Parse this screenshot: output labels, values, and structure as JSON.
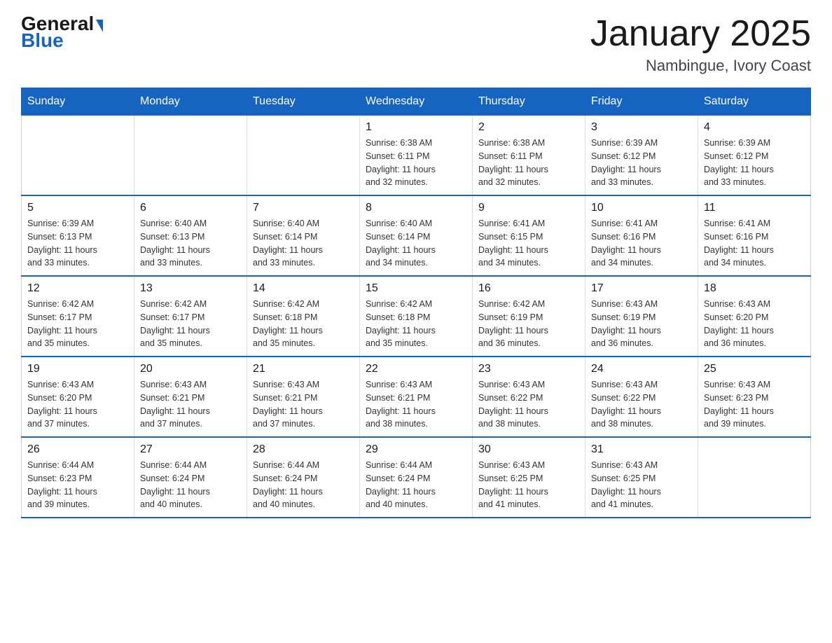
{
  "logo": {
    "general": "General",
    "blue": "Blue"
  },
  "title": "January 2025",
  "location": "Nambingue, Ivory Coast",
  "days_of_week": [
    "Sunday",
    "Monday",
    "Tuesday",
    "Wednesday",
    "Thursday",
    "Friday",
    "Saturday"
  ],
  "weeks": [
    [
      {
        "day": "",
        "info": ""
      },
      {
        "day": "",
        "info": ""
      },
      {
        "day": "",
        "info": ""
      },
      {
        "day": "1",
        "info": "Sunrise: 6:38 AM\nSunset: 6:11 PM\nDaylight: 11 hours\nand 32 minutes."
      },
      {
        "day": "2",
        "info": "Sunrise: 6:38 AM\nSunset: 6:11 PM\nDaylight: 11 hours\nand 32 minutes."
      },
      {
        "day": "3",
        "info": "Sunrise: 6:39 AM\nSunset: 6:12 PM\nDaylight: 11 hours\nand 33 minutes."
      },
      {
        "day": "4",
        "info": "Sunrise: 6:39 AM\nSunset: 6:12 PM\nDaylight: 11 hours\nand 33 minutes."
      }
    ],
    [
      {
        "day": "5",
        "info": "Sunrise: 6:39 AM\nSunset: 6:13 PM\nDaylight: 11 hours\nand 33 minutes."
      },
      {
        "day": "6",
        "info": "Sunrise: 6:40 AM\nSunset: 6:13 PM\nDaylight: 11 hours\nand 33 minutes."
      },
      {
        "day": "7",
        "info": "Sunrise: 6:40 AM\nSunset: 6:14 PM\nDaylight: 11 hours\nand 33 minutes."
      },
      {
        "day": "8",
        "info": "Sunrise: 6:40 AM\nSunset: 6:14 PM\nDaylight: 11 hours\nand 34 minutes."
      },
      {
        "day": "9",
        "info": "Sunrise: 6:41 AM\nSunset: 6:15 PM\nDaylight: 11 hours\nand 34 minutes."
      },
      {
        "day": "10",
        "info": "Sunrise: 6:41 AM\nSunset: 6:16 PM\nDaylight: 11 hours\nand 34 minutes."
      },
      {
        "day": "11",
        "info": "Sunrise: 6:41 AM\nSunset: 6:16 PM\nDaylight: 11 hours\nand 34 minutes."
      }
    ],
    [
      {
        "day": "12",
        "info": "Sunrise: 6:42 AM\nSunset: 6:17 PM\nDaylight: 11 hours\nand 35 minutes."
      },
      {
        "day": "13",
        "info": "Sunrise: 6:42 AM\nSunset: 6:17 PM\nDaylight: 11 hours\nand 35 minutes."
      },
      {
        "day": "14",
        "info": "Sunrise: 6:42 AM\nSunset: 6:18 PM\nDaylight: 11 hours\nand 35 minutes."
      },
      {
        "day": "15",
        "info": "Sunrise: 6:42 AM\nSunset: 6:18 PM\nDaylight: 11 hours\nand 35 minutes."
      },
      {
        "day": "16",
        "info": "Sunrise: 6:42 AM\nSunset: 6:19 PM\nDaylight: 11 hours\nand 36 minutes."
      },
      {
        "day": "17",
        "info": "Sunrise: 6:43 AM\nSunset: 6:19 PM\nDaylight: 11 hours\nand 36 minutes."
      },
      {
        "day": "18",
        "info": "Sunrise: 6:43 AM\nSunset: 6:20 PM\nDaylight: 11 hours\nand 36 minutes."
      }
    ],
    [
      {
        "day": "19",
        "info": "Sunrise: 6:43 AM\nSunset: 6:20 PM\nDaylight: 11 hours\nand 37 minutes."
      },
      {
        "day": "20",
        "info": "Sunrise: 6:43 AM\nSunset: 6:21 PM\nDaylight: 11 hours\nand 37 minutes."
      },
      {
        "day": "21",
        "info": "Sunrise: 6:43 AM\nSunset: 6:21 PM\nDaylight: 11 hours\nand 37 minutes."
      },
      {
        "day": "22",
        "info": "Sunrise: 6:43 AM\nSunset: 6:21 PM\nDaylight: 11 hours\nand 38 minutes."
      },
      {
        "day": "23",
        "info": "Sunrise: 6:43 AM\nSunset: 6:22 PM\nDaylight: 11 hours\nand 38 minutes."
      },
      {
        "day": "24",
        "info": "Sunrise: 6:43 AM\nSunset: 6:22 PM\nDaylight: 11 hours\nand 38 minutes."
      },
      {
        "day": "25",
        "info": "Sunrise: 6:43 AM\nSunset: 6:23 PM\nDaylight: 11 hours\nand 39 minutes."
      }
    ],
    [
      {
        "day": "26",
        "info": "Sunrise: 6:44 AM\nSunset: 6:23 PM\nDaylight: 11 hours\nand 39 minutes."
      },
      {
        "day": "27",
        "info": "Sunrise: 6:44 AM\nSunset: 6:24 PM\nDaylight: 11 hours\nand 40 minutes."
      },
      {
        "day": "28",
        "info": "Sunrise: 6:44 AM\nSunset: 6:24 PM\nDaylight: 11 hours\nand 40 minutes."
      },
      {
        "day": "29",
        "info": "Sunrise: 6:44 AM\nSunset: 6:24 PM\nDaylight: 11 hours\nand 40 minutes."
      },
      {
        "day": "30",
        "info": "Sunrise: 6:43 AM\nSunset: 6:25 PM\nDaylight: 11 hours\nand 41 minutes."
      },
      {
        "day": "31",
        "info": "Sunrise: 6:43 AM\nSunset: 6:25 PM\nDaylight: 11 hours\nand 41 minutes."
      },
      {
        "day": "",
        "info": ""
      }
    ]
  ]
}
